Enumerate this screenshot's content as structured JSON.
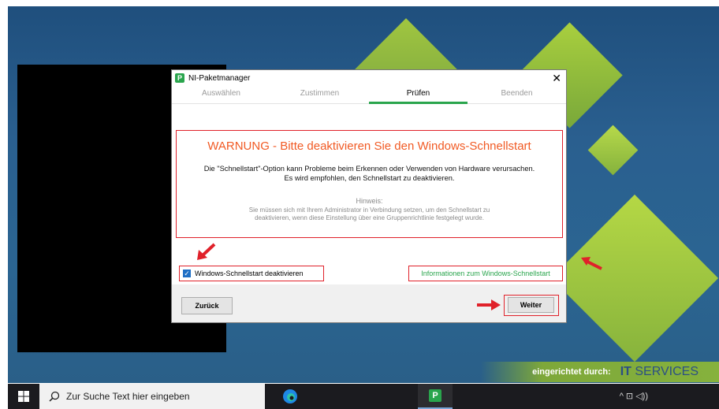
{
  "dialog": {
    "title": "NI-Paketmanager",
    "close_glyph": "✕",
    "app_icon_letter": "P",
    "tabs": [
      "Auswählen",
      "Zustimmen",
      "Prüfen",
      "Beenden"
    ],
    "active_tab": "Prüfen",
    "warning_title": "WARNUNG - Bitte deaktivieren Sie den Windows-Schnellstart",
    "warning_line1": "Die \"Schnellstart\"-Option kann Probleme beim Erkennen oder Verwenden von Hardware verursachen.",
    "warning_line2": "Es wird empfohlen, den Schnellstart zu deaktivieren.",
    "hint_heading": "Hinweis:",
    "hint_line1": "Sie müssen sich mit Ihrem Administrator in Verbindung setzen, um den Schnellstart zu",
    "hint_line2": "deaktivieren, wenn diese Einstellung über eine Gruppenrichtlinie festgelegt wurde.",
    "checkbox_label": "Windows-Schnellstart deaktivieren",
    "checkbox_checked": true,
    "info_link": "Informationen zum Windows-Schnellstart",
    "back_button": "Zurück",
    "next_button": "Weiter"
  },
  "banner": {
    "small_text": "eingerichtet durch:",
    "big_text_bold": "IT",
    "big_text": "SERVICES"
  },
  "taskbar": {
    "search_placeholder": "Zur Suche Text hier eingeben",
    "tray_text": "^ ⊡ ◁))"
  },
  "colors": {
    "accent_green": "#2aa54d",
    "warning_orange": "#f15a24",
    "annotation_red": "#e0212a"
  }
}
